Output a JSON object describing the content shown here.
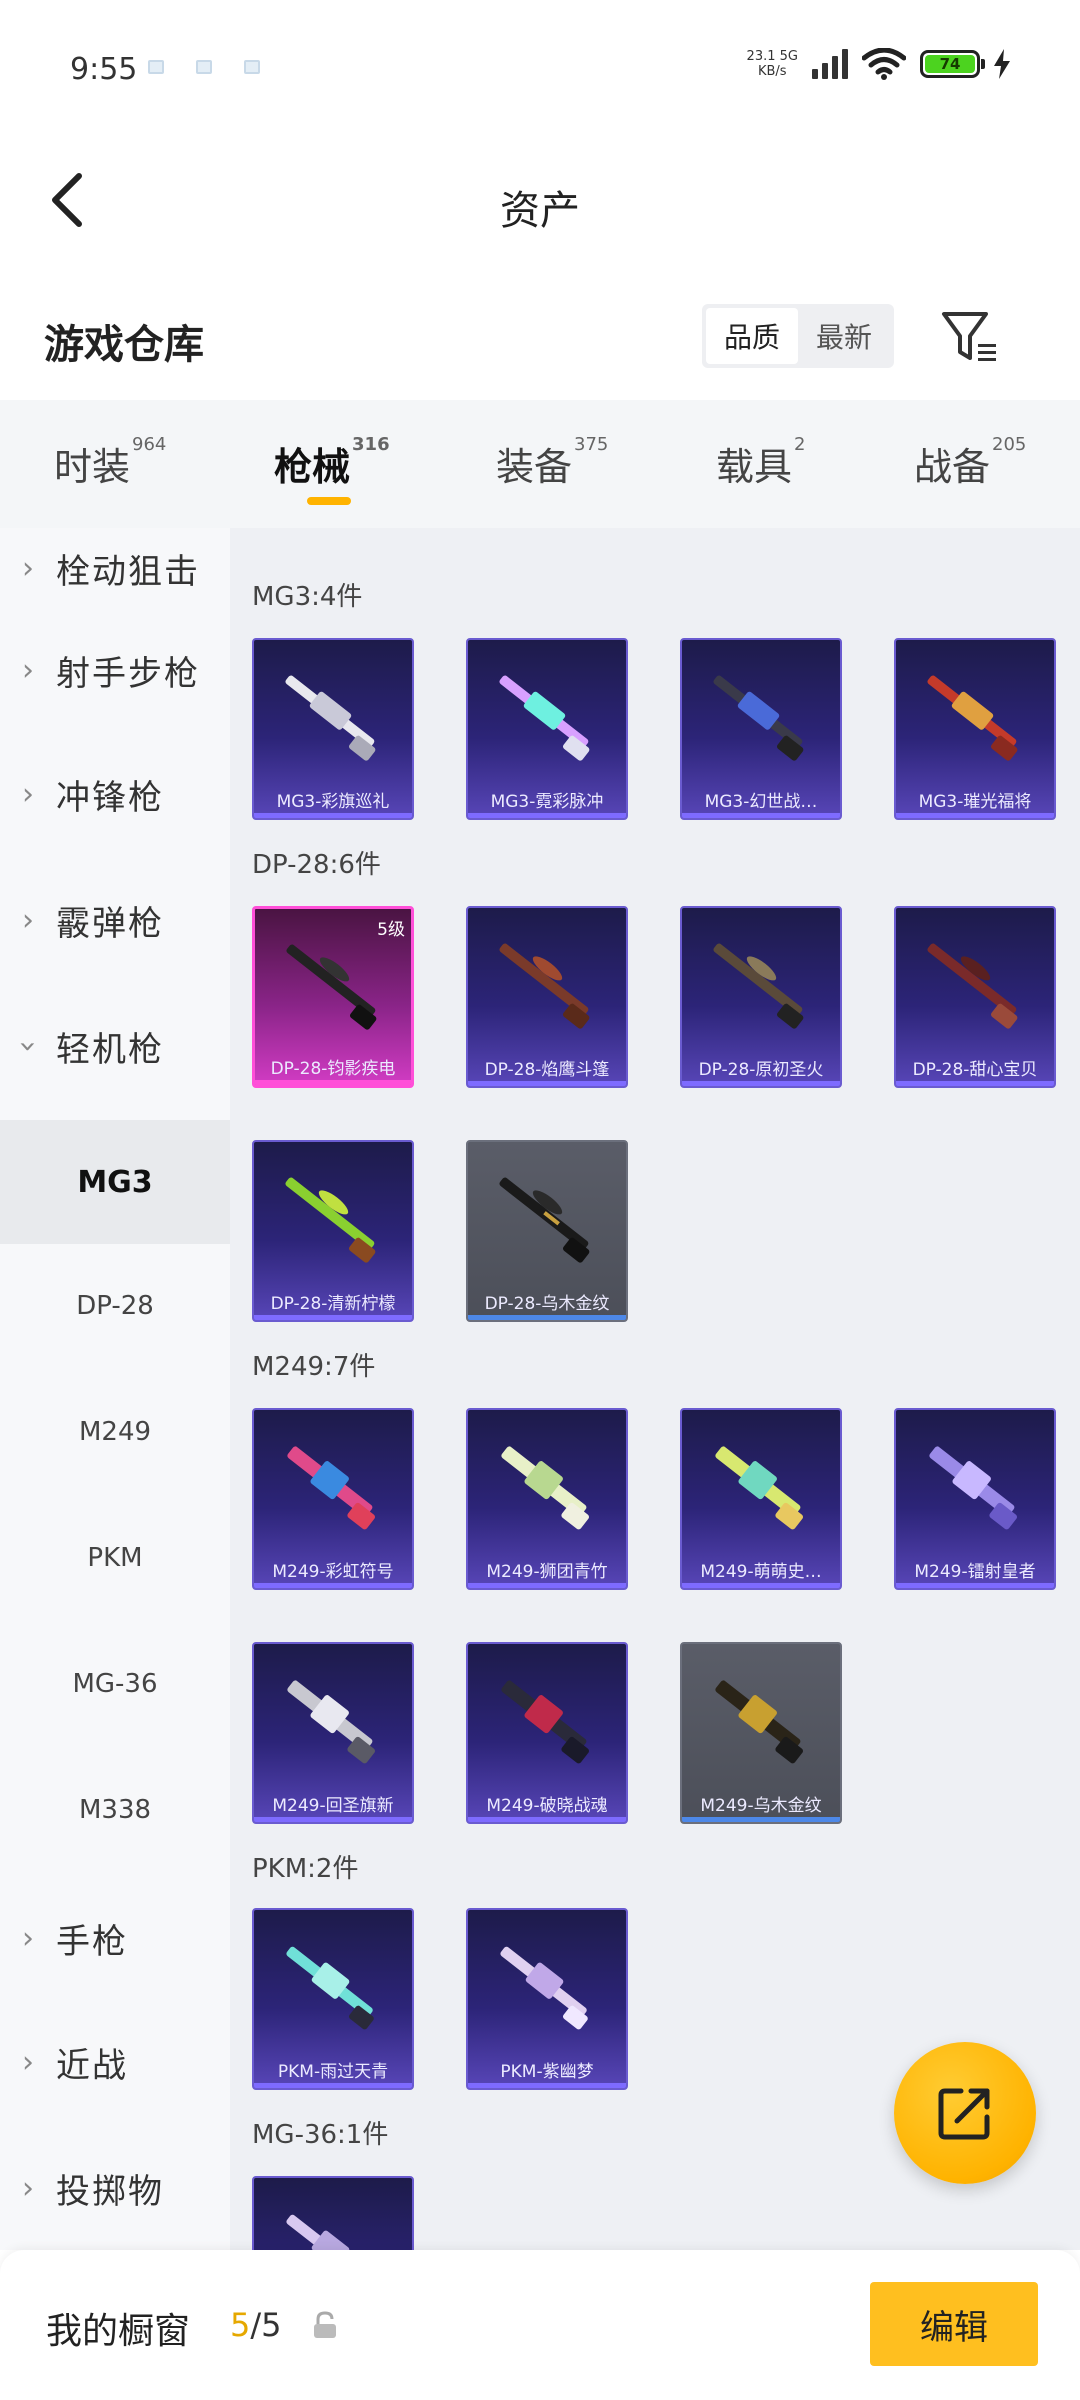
{
  "status_bar": {
    "time": "9:55",
    "net_speed_value": "23.1",
    "net_speed_unit": "KB/s",
    "network_type": "5G",
    "battery_level": "74"
  },
  "header": {
    "title": "资产"
  },
  "warehouse": {
    "title": "游戏仓库",
    "sort_options": [
      "品质",
      "最新"
    ],
    "active_sort": "品质"
  },
  "tabs": [
    {
      "label": "时装",
      "count": "964"
    },
    {
      "label": "枪械",
      "count": "316",
      "active": true
    },
    {
      "label": "装备",
      "count": "375"
    },
    {
      "label": "载具",
      "count": "2"
    },
    {
      "label": "战备",
      "count": "205"
    }
  ],
  "sidebar": {
    "categories": [
      "栓动狙击",
      "射手步枪",
      "冲锋枪",
      "霰弹枪",
      "轻机枪",
      "手枪",
      "近战",
      "投掷物"
    ],
    "expanded": "轻机枪",
    "subitems": [
      "MG3",
      "DP-28",
      "M249",
      "PKM",
      "MG-36",
      "M338"
    ],
    "active_sub": "MG3"
  },
  "groups": {
    "mg3": {
      "title": "MG3:4件",
      "items": [
        "MG3-彩旗巡礼",
        "MG3-霓彩脉冲",
        "MG3-幻世战…",
        "MG3-璀光福将"
      ]
    },
    "dp28": {
      "title": "DP-28:6件",
      "badge": "5级",
      "items": [
        "DP-28-钧影疾电",
        "DP-28-焰鹰斗篷",
        "DP-28-原初圣火",
        "DP-28-甜心宝贝",
        "DP-28-清新柠檬",
        "DP-28-乌木金纹"
      ]
    },
    "m249": {
      "title": "M249:7件",
      "items": [
        "M249-彩虹符号",
        "M249-狮团青竹",
        "M249-萌萌史…",
        "M249-镭射皇者",
        "M249-回圣旗新",
        "M249-破晓战魂",
        "M249-乌木金纹"
      ]
    },
    "pkm": {
      "title": "PKM:2件",
      "items": [
        "PKM-雨过天青",
        "PKM-紫幽梦"
      ]
    },
    "mg36": {
      "title": "MG-36:1件"
    }
  },
  "bottom": {
    "showcase_label": "我的橱窗",
    "showcase_current": "5",
    "showcase_total": "/5",
    "edit_label": "编辑"
  },
  "colors": {
    "accent": "#ffb300",
    "card_purple": "#2c2478",
    "card_pink": "#d23cc4",
    "card_gray": "#4c4f59"
  }
}
